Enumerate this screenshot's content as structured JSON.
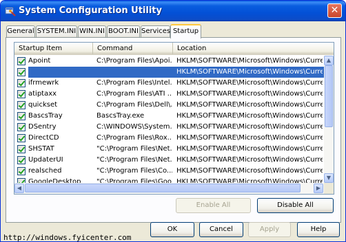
{
  "window": {
    "title": "System Configuration Utility",
    "close_glyph": "✕"
  },
  "tabs": [
    {
      "label": "General"
    },
    {
      "label": "SYSTEM.INI"
    },
    {
      "label": "WIN.INI"
    },
    {
      "label": "BOOT.INI"
    },
    {
      "label": "Services"
    },
    {
      "label": "Startup",
      "active": true
    }
  ],
  "list": {
    "columns": [
      "Startup Item",
      "Command",
      "Location"
    ],
    "rows": [
      {
        "item": "Apoint",
        "command": "C:\\Program Files\\Apoi...",
        "location": "HKLM\\SOFTWARE\\Microsoft\\Windows\\CurrentVe...",
        "checked": true,
        "selected": false
      },
      {
        "item": "",
        "command": "",
        "location": "HKLM\\SOFTWARE\\Microsoft\\Windows\\CurrentVe...",
        "checked": true,
        "selected": true
      },
      {
        "item": "ifrmewrk",
        "command": "C:\\Program Files\\Intel...",
        "location": "HKLM\\SOFTWARE\\Microsoft\\Windows\\CurrentVe...",
        "checked": true,
        "selected": false
      },
      {
        "item": "atiptaxx",
        "command": "C:\\Program Files\\ATI ...",
        "location": "HKLM\\SOFTWARE\\Microsoft\\Windows\\CurrentVe...",
        "checked": true,
        "selected": false
      },
      {
        "item": "quickset",
        "command": "C:\\Program Files\\Dell\\...",
        "location": "HKLM\\SOFTWARE\\Microsoft\\Windows\\CurrentVe...",
        "checked": true,
        "selected": false
      },
      {
        "item": "BascsTray",
        "command": "BascsTray.exe",
        "location": "HKLM\\SOFTWARE\\Microsoft\\Windows\\CurrentVe...",
        "checked": true,
        "selected": false
      },
      {
        "item": "DSentry",
        "command": "C:\\WINDOWS\\System...",
        "location": "HKLM\\SOFTWARE\\Microsoft\\Windows\\CurrentVe...",
        "checked": true,
        "selected": false
      },
      {
        "item": "DirectCD",
        "command": "C:\\Program Files\\Rox...",
        "location": "HKLM\\SOFTWARE\\Microsoft\\Windows\\CurrentVe...",
        "checked": true,
        "selected": false
      },
      {
        "item": "SHSTAT",
        "command": "\"C:\\Program Files\\Net...",
        "location": "HKLM\\SOFTWARE\\Microsoft\\Windows\\CurrentVe...",
        "checked": true,
        "selected": false
      },
      {
        "item": "UpdaterUI",
        "command": "\"C:\\Program Files\\Net...",
        "location": "HKLM\\SOFTWARE\\Microsoft\\Windows\\CurrentVe...",
        "checked": true,
        "selected": false
      },
      {
        "item": "realsched",
        "command": "\"C:\\Program Files\\Co...",
        "location": "HKLM\\SOFTWARE\\Microsoft\\Windows\\CurrentVe...",
        "checked": true,
        "selected": false
      },
      {
        "item": "GoogleDesktop",
        "command": "\"C:\\Program Files\\Goo...",
        "location": "HKLM\\SOFTWARE\\Microsoft\\Windows\\CurrentVe...",
        "checked": true,
        "selected": false
      }
    ]
  },
  "buttons": {
    "enable_all": "Enable All",
    "disable_all": "Disable All",
    "ok": "OK",
    "cancel": "Cancel",
    "apply": "Apply",
    "help": "Help"
  },
  "watermark": "http://windows.fyicenter.com",
  "colors": {
    "title_bar": "#0a5ddf",
    "selection": "#316ac5",
    "active_tab_accent": "#ffc83c"
  }
}
